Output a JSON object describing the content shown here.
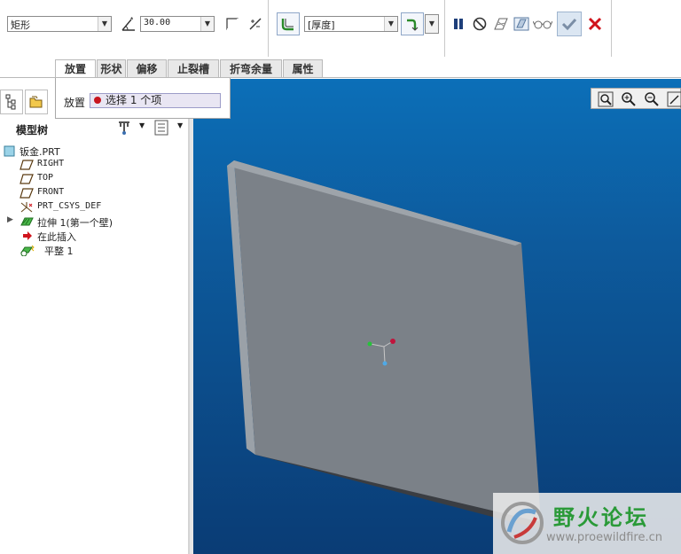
{
  "dashboard": {
    "shape_type": "矩形",
    "angle_value": "30.00",
    "thickness_option": "[厚度]"
  },
  "tabs": [
    "放置",
    "形状",
    "偏移",
    "止裂槽",
    "折弯余量",
    "属性"
  ],
  "placement_panel": {
    "label": "放置",
    "collector_text": "选择 1 个项"
  },
  "navigator": {
    "title": "模型树",
    "tree": [
      {
        "label": "钣金.PRT",
        "icon": "part-icon"
      },
      {
        "label": "RIGHT",
        "icon": "datum-plane-icon"
      },
      {
        "label": "TOP",
        "icon": "datum-plane-icon"
      },
      {
        "label": "FRONT",
        "icon": "datum-plane-icon"
      },
      {
        "label": "PRT_CSYS_DEF",
        "icon": "csys-icon"
      },
      {
        "label": "拉伸 1(第一个壁)",
        "icon": "extrude-wall-icon"
      },
      {
        "label": "在此插入",
        "icon": "insert-here-arrow-icon"
      },
      {
        "label": "平整 1",
        "icon": "flat-wall-icon"
      }
    ]
  },
  "watermark": {
    "title": "野火论坛",
    "url": "www.proewildfire.cn"
  },
  "colors": {
    "background_top": "#0c6fb8",
    "background_bottom": "#0a3c75",
    "part_face": "#7b8188",
    "cancel_red": "#d0141c",
    "watermark_green": "#2a9a38"
  }
}
